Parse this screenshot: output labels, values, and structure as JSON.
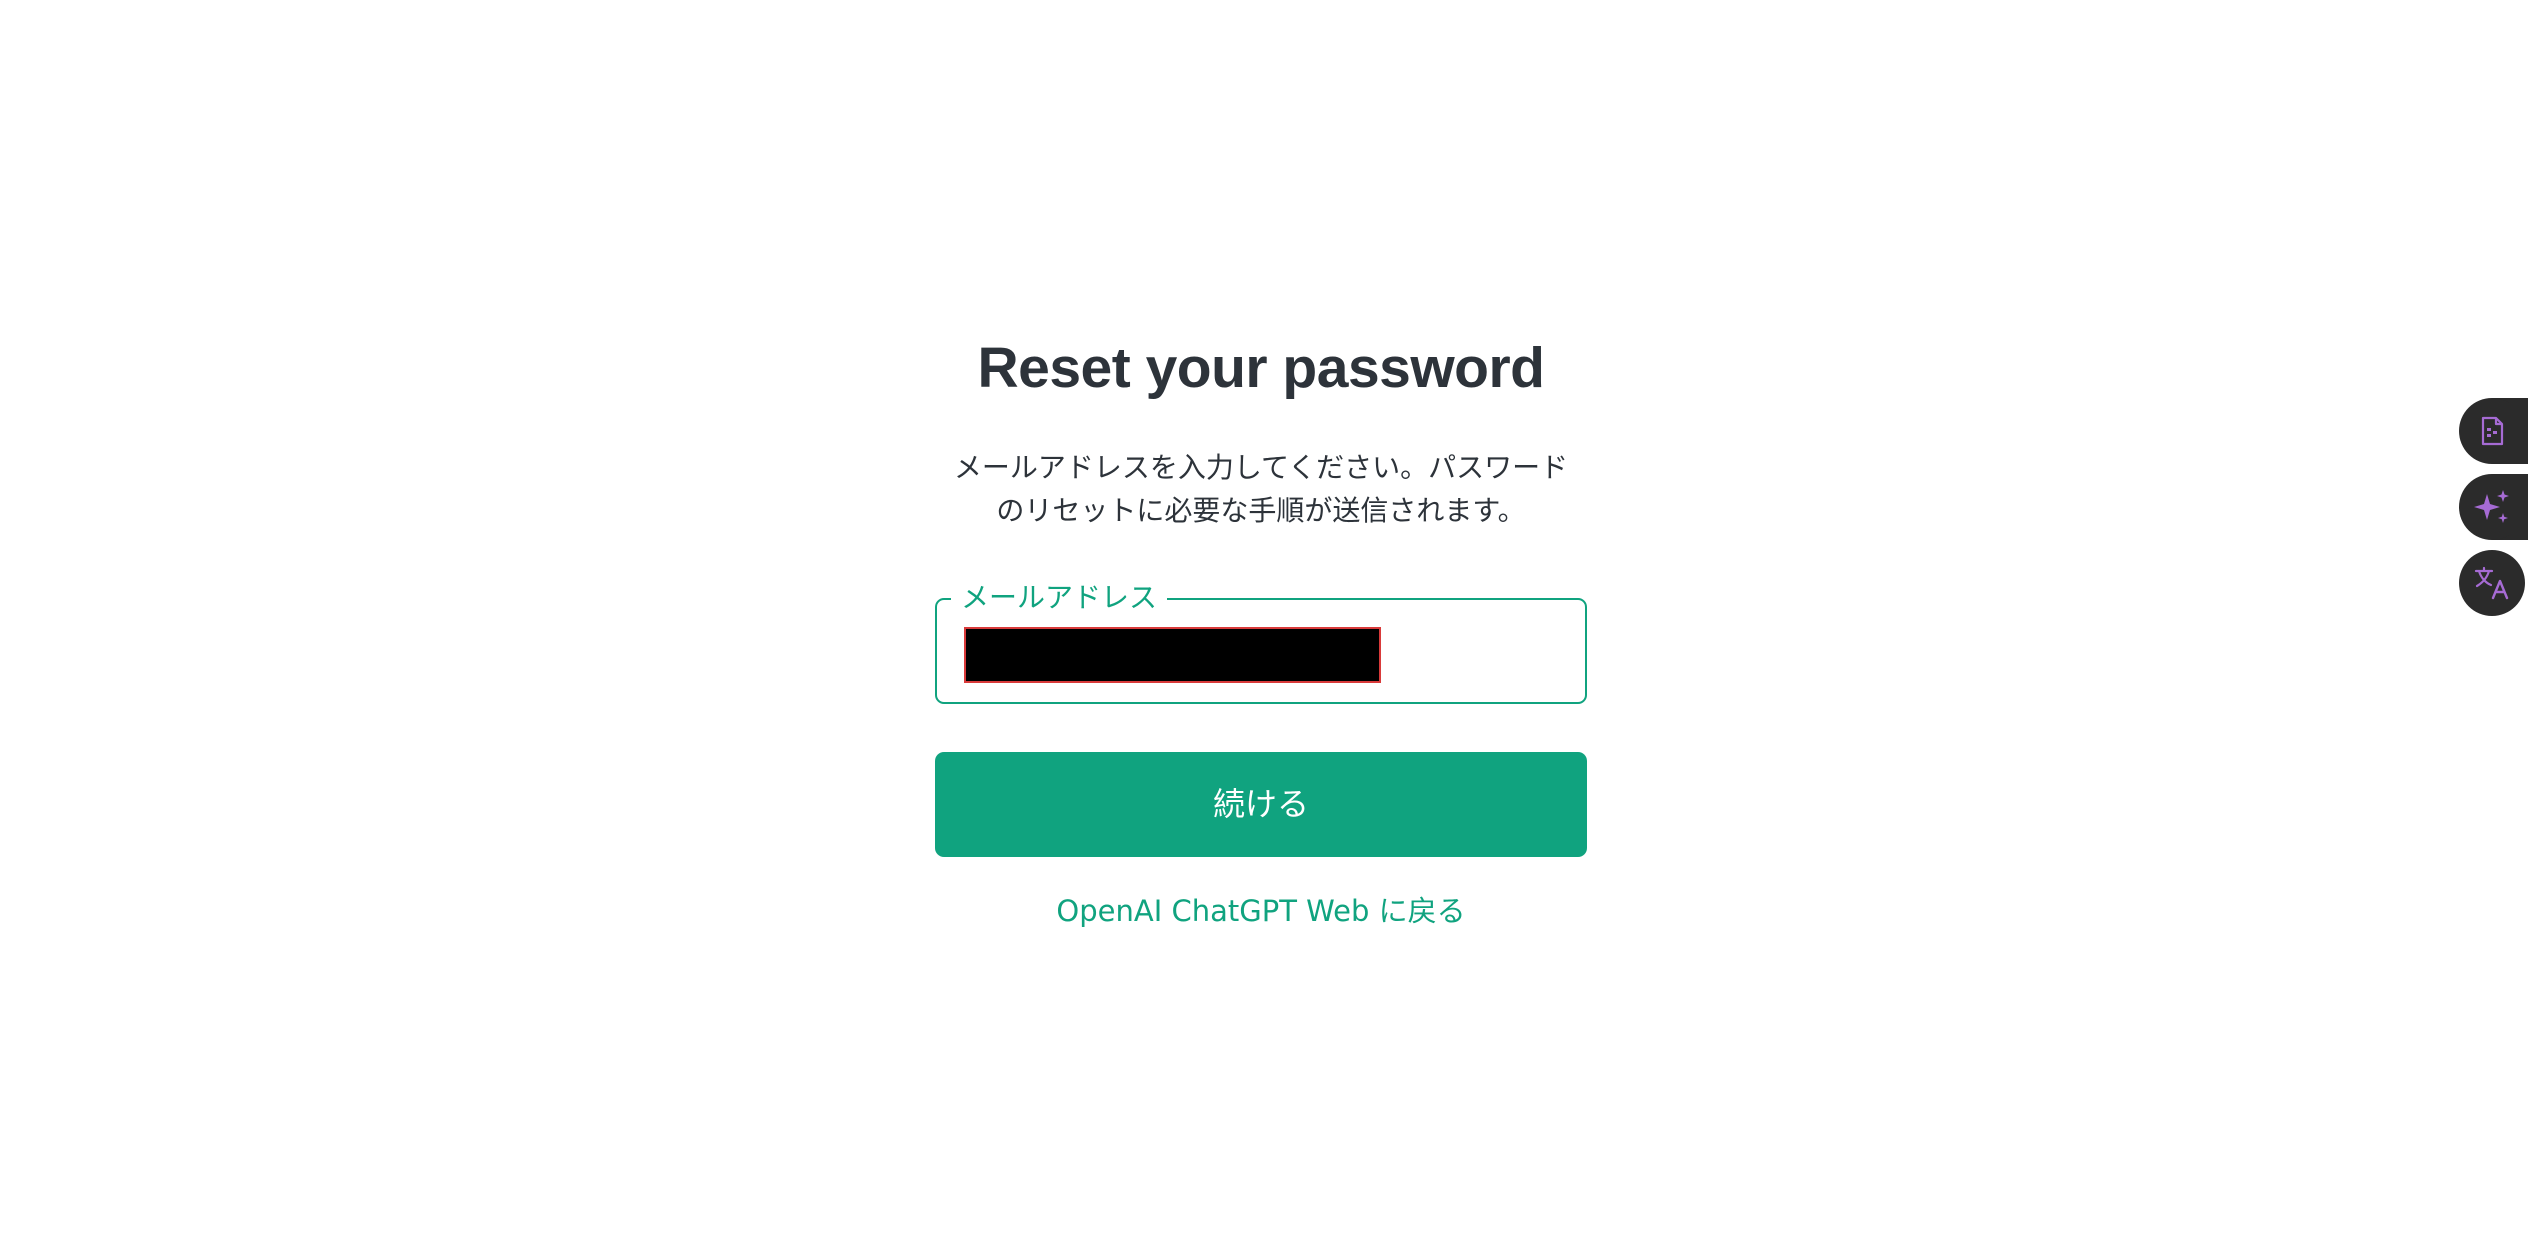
{
  "reset": {
    "title": "Reset your password",
    "description_line1": "メールアドレスを入力してください。パスワード",
    "description_line2": "のリセットに必要な手順が送信されます。",
    "email_label": "メールアドレス",
    "email_value": "",
    "continue_label": "続ける",
    "back_link": "OpenAI ChatGPT Web に戻る"
  },
  "side_tools": [
    {
      "icon": "document-icon"
    },
    {
      "icon": "sparkle-icon"
    },
    {
      "icon": "translate-icon"
    }
  ],
  "colors": {
    "accent": "#10a37f",
    "title_text": "#2d333a",
    "tool_background": "#2b2b2b",
    "tool_icon": "#a66bd4",
    "redaction_border": "#d93a3a"
  }
}
